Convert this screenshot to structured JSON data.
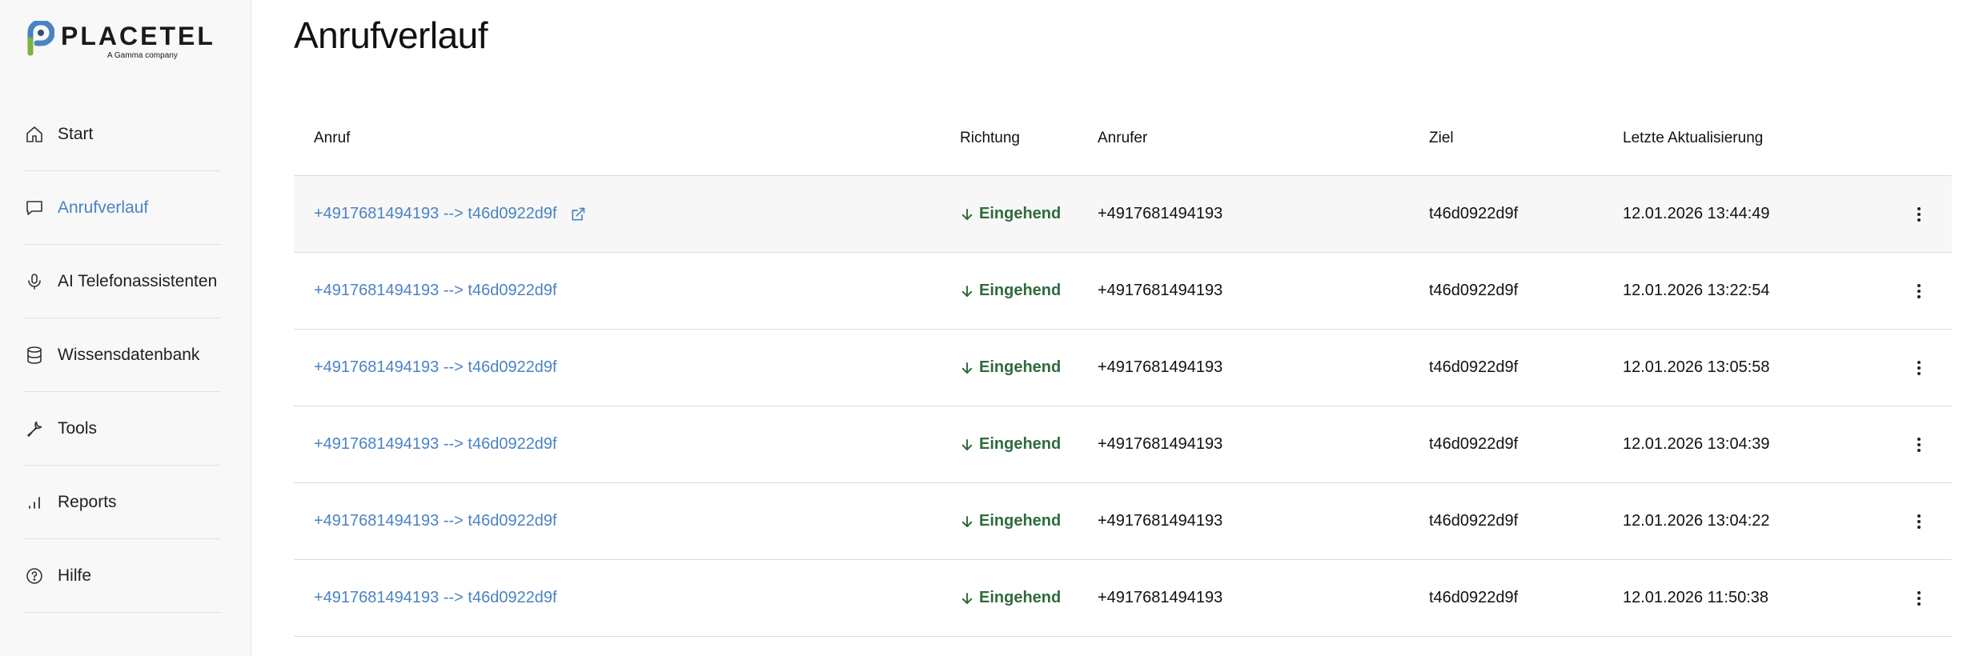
{
  "brand": {
    "name": "PLACETEL",
    "tagline": "A Gamma company",
    "colors": {
      "blue": "#4a83c4",
      "green": "#7cb342",
      "dark": "#2b4f7a"
    }
  },
  "sidebar": {
    "items": [
      {
        "label": "Start",
        "icon": "home-icon",
        "active": false
      },
      {
        "label": "Anrufverlauf",
        "icon": "chat-icon",
        "active": true
      },
      {
        "label": "AI Telefonassistenten",
        "icon": "microphone-icon",
        "active": false
      },
      {
        "label": "Wissensdatenbank",
        "icon": "database-icon",
        "active": false
      },
      {
        "label": "Tools",
        "icon": "wrench-icon",
        "active": false
      },
      {
        "label": "Reports",
        "icon": "bar-chart-icon",
        "active": false
      },
      {
        "label": "Hilfe",
        "icon": "help-circle-icon",
        "active": false
      }
    ]
  },
  "page": {
    "title": "Anrufverlauf"
  },
  "table": {
    "headers": {
      "anruf": "Anruf",
      "richtung": "Richtung",
      "anrufer": "Anrufer",
      "ziel": "Ziel",
      "update": "Letzte Aktualisierung"
    },
    "rows": [
      {
        "anruf": "+4917681494193 --> t46d0922d9f",
        "richtung": "Eingehend",
        "anrufer": "+4917681494193",
        "ziel": "t46d0922d9f",
        "update": "12.01.2026 13:44:49"
      },
      {
        "anruf": "+4917681494193 --> t46d0922d9f",
        "richtung": "Eingehend",
        "anrufer": "+4917681494193",
        "ziel": "t46d0922d9f",
        "update": "12.01.2026 13:22:54"
      },
      {
        "anruf": "+4917681494193 --> t46d0922d9f",
        "richtung": "Eingehend",
        "anrufer": "+4917681494193",
        "ziel": "t46d0922d9f",
        "update": "12.01.2026 13:05:58"
      },
      {
        "anruf": "+4917681494193 --> t46d0922d9f",
        "richtung": "Eingehend",
        "anrufer": "+4917681494193",
        "ziel": "t46d0922d9f",
        "update": "12.01.2026 13:04:39"
      },
      {
        "anruf": "+4917681494193 --> t46d0922d9f",
        "richtung": "Eingehend",
        "anrufer": "+4917681494193",
        "ziel": "t46d0922d9f",
        "update": "12.01.2026 13:04:22"
      },
      {
        "anruf": "+4917681494193 --> t46d0922d9f",
        "richtung": "Eingehend",
        "anrufer": "+4917681494193",
        "ziel": "t46d0922d9f",
        "update": "12.01.2026 11:50:38"
      }
    ]
  }
}
